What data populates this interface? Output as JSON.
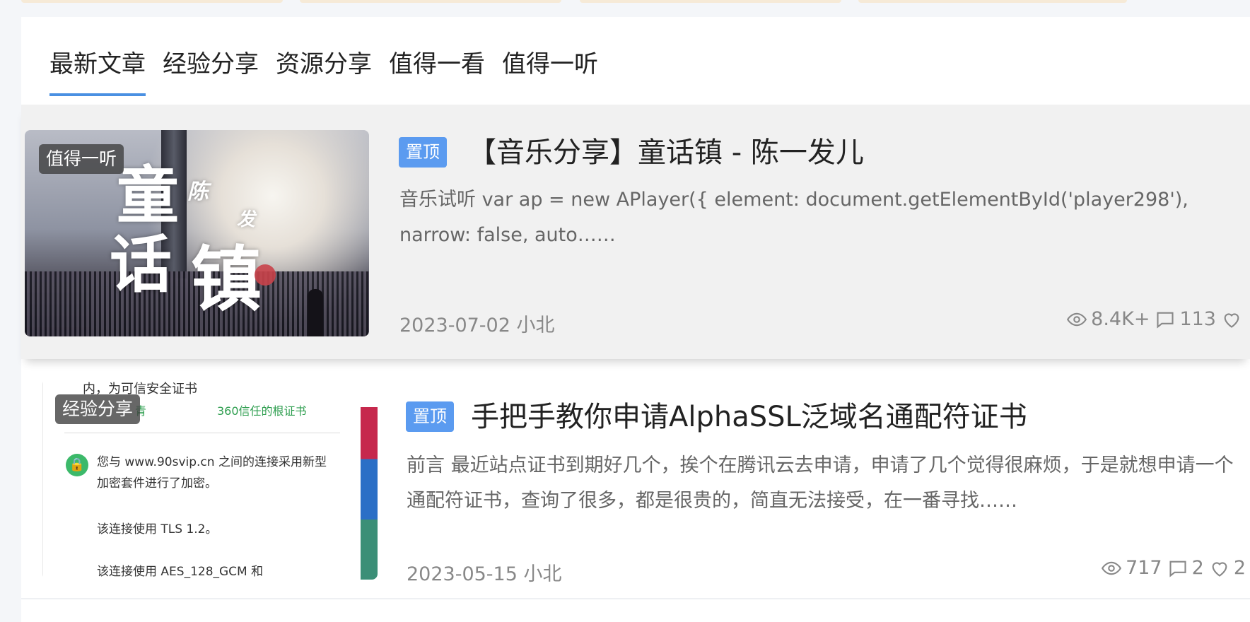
{
  "tabs": [
    {
      "label": "最新文章"
    },
    {
      "label": "经验分享"
    },
    {
      "label": "资源分享"
    },
    {
      "label": "值得一看"
    },
    {
      "label": "值得一听"
    }
  ],
  "active_tab": "最新文章",
  "colors": {
    "accent": "#4a90e2",
    "pin": "#5b9bf0"
  },
  "posts": [
    {
      "category": "值得一听",
      "pin": "置顶",
      "title": "【音乐分享】童话镇 - 陈一发儿",
      "excerpt": "音乐试听 var ap = new APlayer({ element: document.getElementById('player298'), narrow: false, auto……",
      "date_author": "2023-07-02 小北",
      "views": "8.4K+",
      "comments": "113",
      "likes": "",
      "thumb_text": {
        "a": "童",
        "b": "话",
        "c": "镇",
        "d": "陈",
        "e": "发"
      }
    },
    {
      "category": "经验分享",
      "pin": "置顶",
      "title": "手把手教你申请AlphaSSL泛域名通配符证书",
      "excerpt": "前言 最近站点证书到期好几个，挨个在腾讯云去申请，申请了几个觉得很麻烦，于是就想申请一个通配符证书，查询了很多，都是很贵的，简直无法接受，在一番寻找……",
      "date_author": "2023-05-15 小北",
      "views": "717",
      "comments": "2",
      "likes": "2",
      "thumb_text": {
        "line1": "内，为可信安全证书",
        "trust_left": "青",
        "trust": "360信任的根证书",
        "msg": "您与 www.90svip.cn 之间的连接采用新型加密套件进行了加密。",
        "tls": "该连接使用 TLS 1.2。",
        "aes": "该连接使用 AES_128_GCM 和"
      }
    }
  ]
}
